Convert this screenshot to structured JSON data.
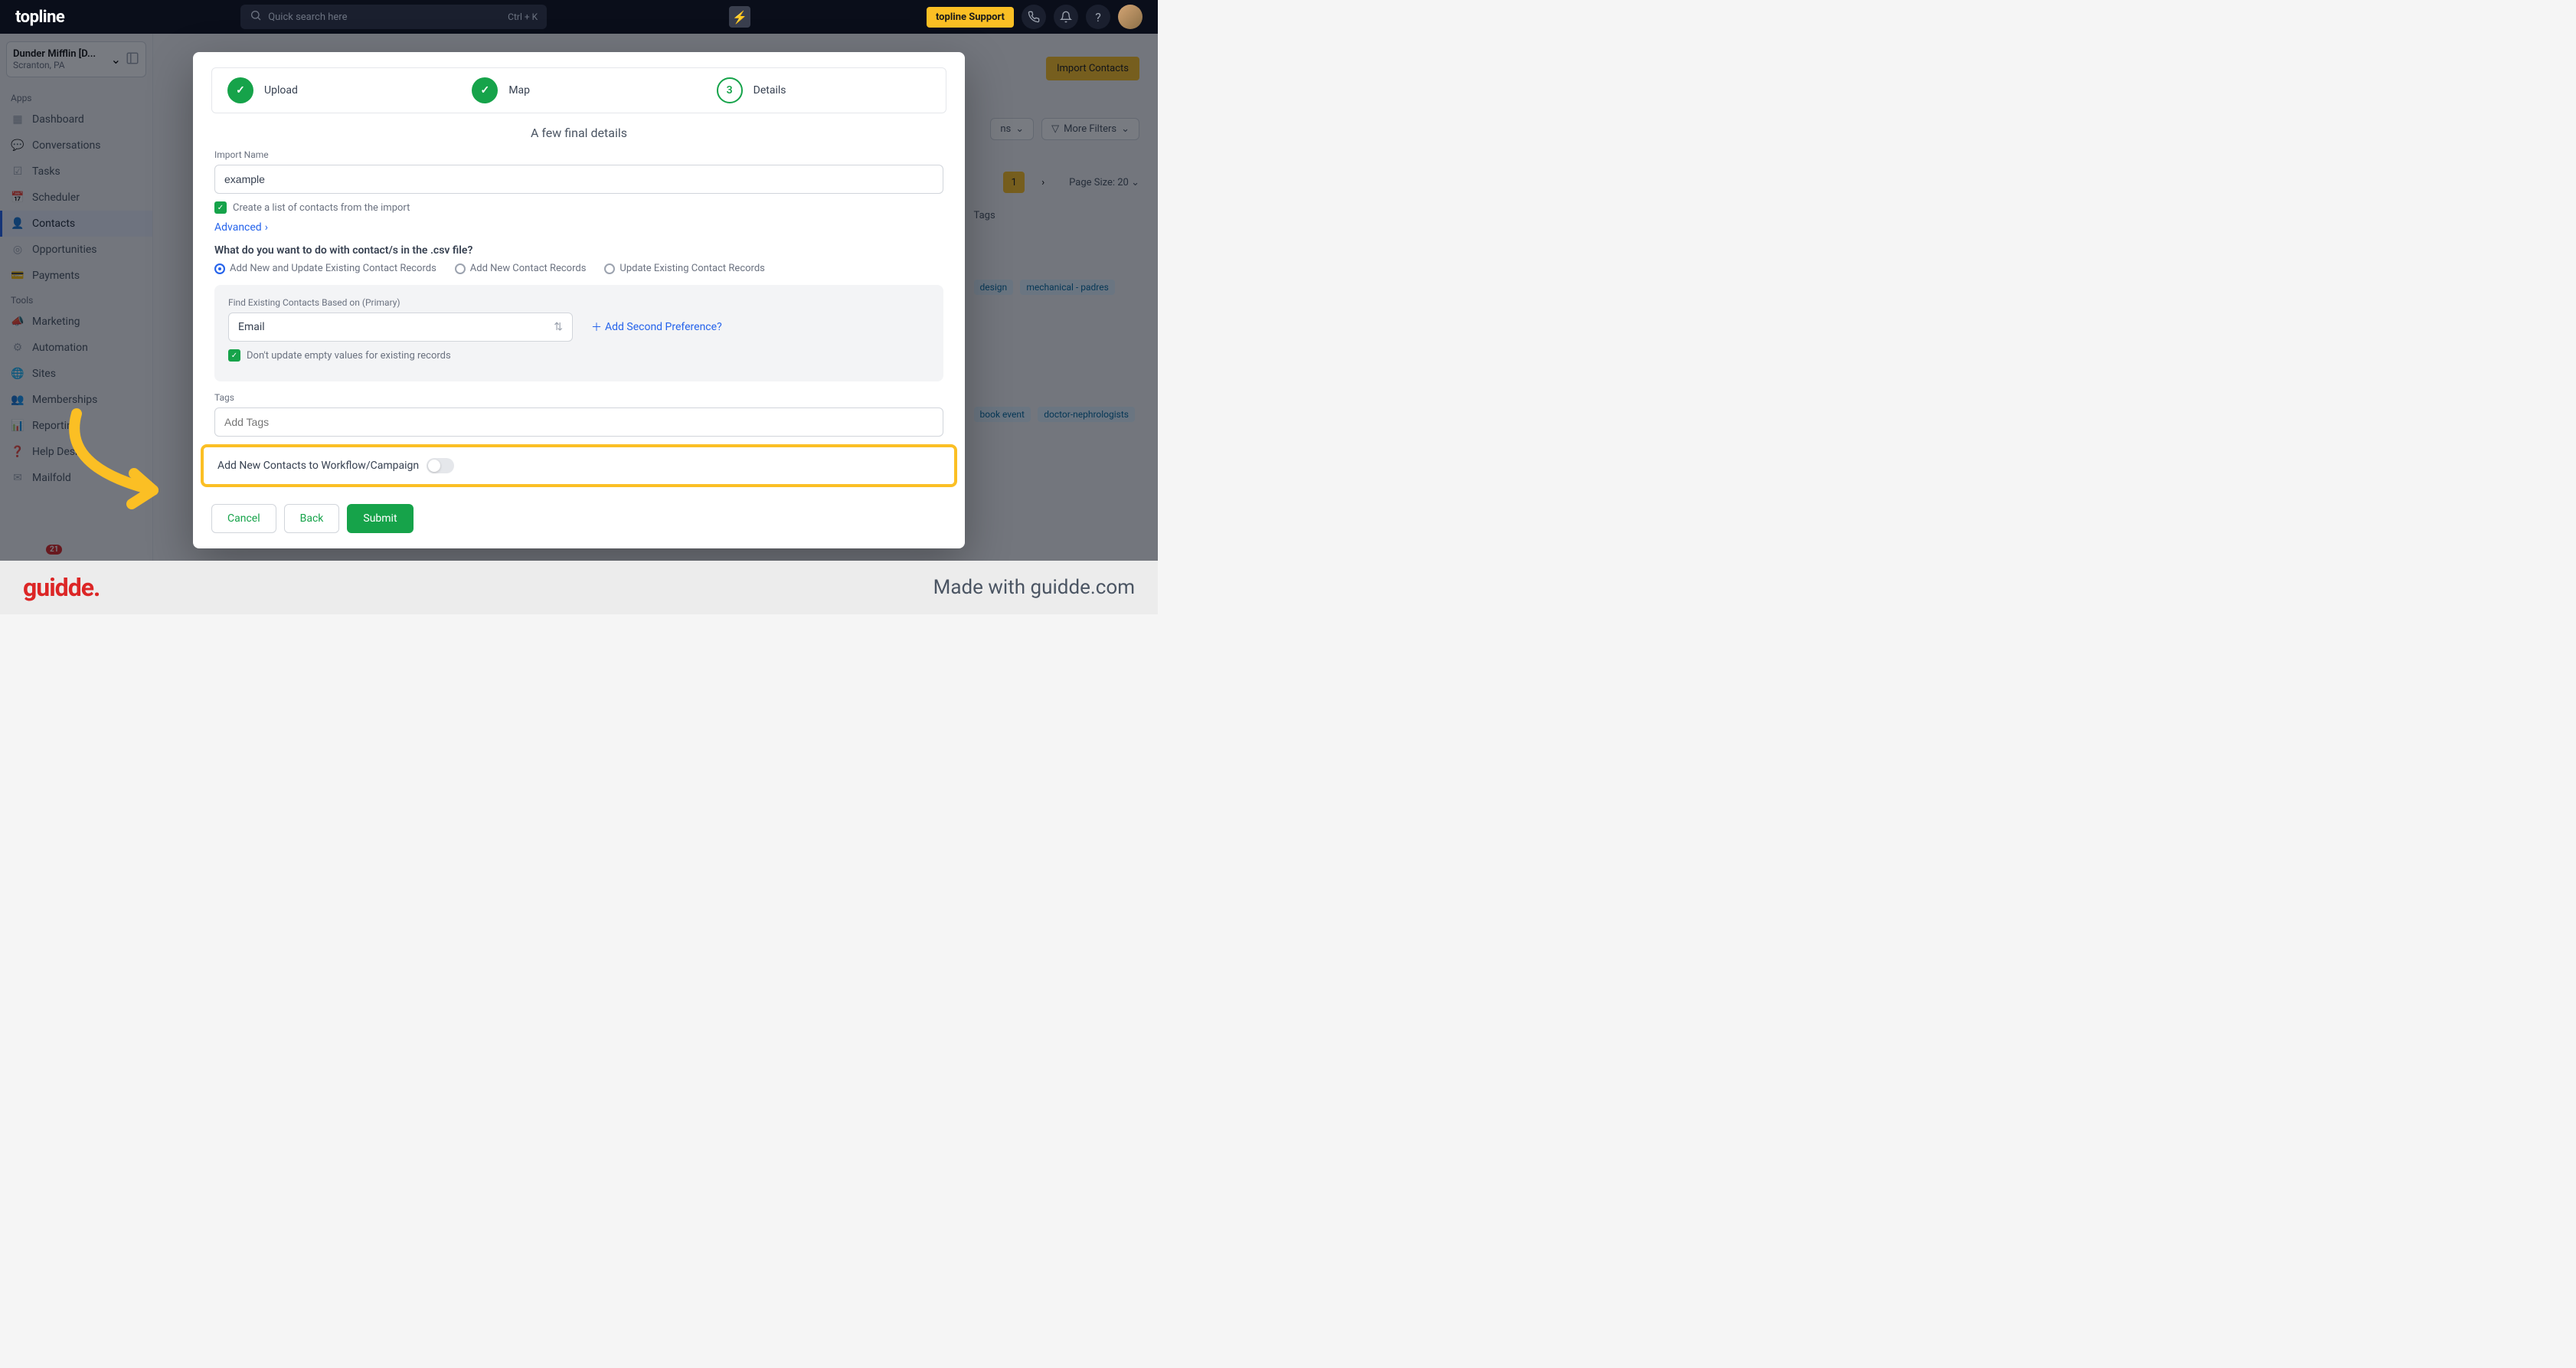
{
  "header": {
    "logo": "topline",
    "search_placeholder": "Quick search here",
    "search_kbd": "Ctrl + K",
    "support_label": "topline Support"
  },
  "org": {
    "name": "Dunder Mifflin [D...",
    "location": "Scranton, PA"
  },
  "sidebar": {
    "apps_label": "Apps",
    "tools_label": "Tools",
    "apps": [
      {
        "label": "Dashboard"
      },
      {
        "label": "Conversations"
      },
      {
        "label": "Tasks"
      },
      {
        "label": "Scheduler"
      },
      {
        "label": "Contacts"
      },
      {
        "label": "Opportunities"
      },
      {
        "label": "Payments"
      }
    ],
    "tools": [
      {
        "label": "Marketing"
      },
      {
        "label": "Automation"
      },
      {
        "label": "Sites"
      },
      {
        "label": "Memberships"
      },
      {
        "label": "Reporting"
      },
      {
        "label": "Help Desk"
      },
      {
        "label": "Mailfold"
      }
    ],
    "notif_count": "21"
  },
  "bg": {
    "import_btn": "Import Contacts",
    "filter_ns": "ns",
    "more_filters": "More Filters",
    "page_num": "1",
    "page_size": "Page Size: 20",
    "tags_header": "Tags",
    "tag1": "design",
    "tag2": "mechanical - padres",
    "tag3": "book event",
    "tag4": "doctor-nephrologists"
  },
  "modal": {
    "steps": [
      {
        "num": "✓",
        "label": "Upload"
      },
      {
        "num": "✓",
        "label": "Map"
      },
      {
        "num": "3",
        "label": "Details"
      }
    ],
    "title": "A few final details",
    "import_name_label": "Import Name",
    "import_name_value": "example",
    "create_list_label": "Create a list of contacts from the import",
    "advanced_label": "Advanced",
    "question": "What do you want to do with contact/s in the .csv file?",
    "radio_options": [
      "Add New and Update Existing Contact Records",
      "Add New Contact Records",
      "Update Existing Contact Records"
    ],
    "find_existing_label": "Find Existing Contacts Based on (Primary)",
    "select_value": "Email",
    "add_second_pref": "Add Second Preference?",
    "dont_update_label": "Don't update empty values for existing records",
    "tags_label": "Tags",
    "tags_placeholder": "Add Tags",
    "workflow_label": "Add New Contacts to Workflow/Campaign",
    "cancel_btn": "Cancel",
    "back_btn": "Back",
    "submit_btn": "Submit"
  },
  "footer": {
    "logo": "guidde.",
    "made_with": "Made with guidde.com"
  }
}
